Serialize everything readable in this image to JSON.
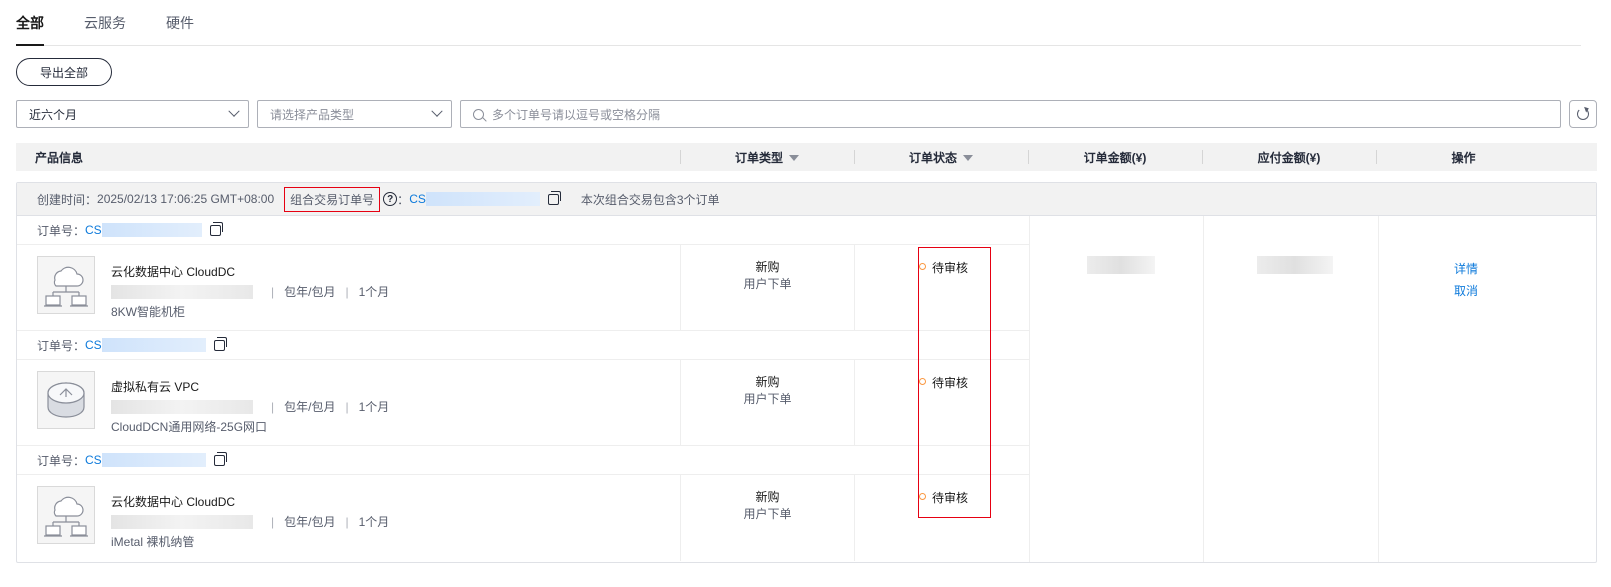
{
  "tabs": [
    {
      "label": "全部",
      "active": true
    },
    {
      "label": "云服务",
      "active": false
    },
    {
      "label": "硬件",
      "active": false
    }
  ],
  "toolbar": {
    "export_label": "导出全部"
  },
  "filters": {
    "time_value": "近六个月",
    "type_placeholder": "请选择产品类型",
    "search_placeholder": "多个订单号请以逗号或空格分隔"
  },
  "table_header": {
    "product_info": "产品信息",
    "order_type": "订单类型",
    "order_status": "订单状态",
    "order_amount": "订单金额(¥)",
    "payable_amount": "应付金额(¥)",
    "actions": "操作"
  },
  "group": {
    "created_label": "创建时间：",
    "created_time": "2025/02/13 17:06:25 GMT+08:00",
    "combo_label": "组合交易订单号",
    "combo_colon": "：",
    "combo_id_prefix": "CS",
    "combo_note": "本次组合交易包含3个订单",
    "accent_color": "#e60012"
  },
  "orders": [
    {
      "order_label": "订单号：",
      "order_id_prefix": "CS",
      "product_name": "云化数据中心 CloudDC",
      "billing": "包年/包月",
      "duration": "1个月",
      "spec": "8KW智能机柜",
      "type_main": "新购",
      "type_sub": "用户下单",
      "status": "待审核",
      "icon": "cloud-network-icon"
    },
    {
      "order_label": "订单号：",
      "order_id_prefix": "CS",
      "product_name": "虚拟私有云 VPC",
      "billing": "包年/包月",
      "duration": "1个月",
      "spec": "CloudDCN通用网络-25G网口",
      "type_main": "新购",
      "type_sub": "用户下单",
      "status": "待审核",
      "icon": "vpc-router-icon"
    },
    {
      "order_label": "订单号：",
      "order_id_prefix": "CS",
      "product_name": "云化数据中心 CloudDC",
      "billing": "包年/包月",
      "duration": "1个月",
      "spec": "iMetal 裸机纳管",
      "type_main": "新购",
      "type_sub": "用户下单",
      "status": "待审核",
      "icon": "cloud-network-icon"
    }
  ],
  "actions": {
    "detail": "详情",
    "cancel": "取消"
  },
  "colors": {
    "link": "#0d7adb",
    "pending_dot": "#fa9841",
    "highlight_box": "#e60012"
  }
}
